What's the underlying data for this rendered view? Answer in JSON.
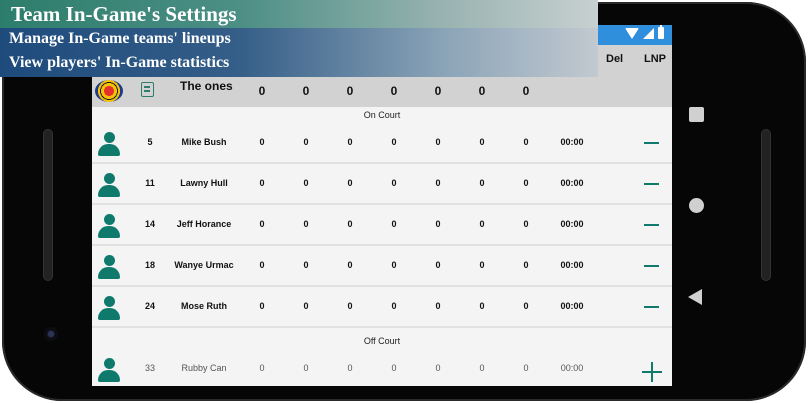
{
  "banner": {
    "title": "Team In-Game's Settings",
    "line1": "Manage In-Game teams' lineups",
    "line2": "View players' In-Game statistics"
  },
  "header": {
    "del_label": "Del",
    "lnp_label": "LNP"
  },
  "team": {
    "name": "The ones",
    "stats": [
      "0",
      "0",
      "0",
      "0",
      "0",
      "0",
      "0"
    ]
  },
  "sections": {
    "on_court": "On Court",
    "off_court": "Off Court"
  },
  "players_on": [
    {
      "number": "5",
      "name": "Mike Bush",
      "stats": [
        "0",
        "0",
        "0",
        "0",
        "0",
        "0",
        "0"
      ],
      "time": "00:00"
    },
    {
      "number": "11",
      "name": "Lawny Hull",
      "stats": [
        "0",
        "0",
        "0",
        "0",
        "0",
        "0",
        "0"
      ],
      "time": "00:00"
    },
    {
      "number": "14",
      "name": "Jeff Horance",
      "stats": [
        "0",
        "0",
        "0",
        "0",
        "0",
        "0",
        "0"
      ],
      "time": "00:00"
    },
    {
      "number": "18",
      "name": "Wanye Urmac",
      "stats": [
        "0",
        "0",
        "0",
        "0",
        "0",
        "0",
        "0"
      ],
      "time": "00:00"
    },
    {
      "number": "24",
      "name": "Mose Ruth",
      "stats": [
        "0",
        "0",
        "0",
        "0",
        "0",
        "0",
        "0"
      ],
      "time": "00:00"
    }
  ],
  "players_off": [
    {
      "number": "33",
      "name": "Rubby Can",
      "stats": [
        "0",
        "0",
        "0",
        "0",
        "0",
        "0",
        "0"
      ],
      "time": "00:00"
    }
  ],
  "colors": {
    "accent": "#0f7a6c",
    "statusbar": "#2f8fdc",
    "header_bg": "#d2d2d2"
  }
}
